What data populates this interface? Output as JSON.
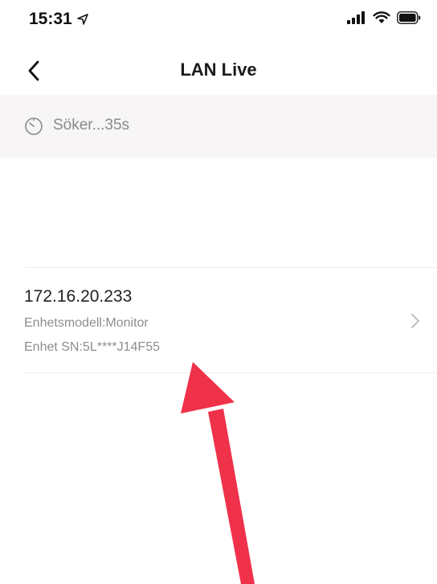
{
  "status_bar": {
    "time": "15:31",
    "location_icon": "location-arrow-icon",
    "signal_icon": "cellular-signal-icon",
    "wifi_icon": "wifi-icon",
    "battery_icon": "battery-icon"
  },
  "nav": {
    "title": "LAN Live",
    "back_icon": "chevron-left-icon"
  },
  "search_banner": {
    "icon": "timer-icon",
    "text": "Söker...35s"
  },
  "devices": [
    {
      "ip": "172.16.20.233",
      "model": "Enhetsmodell:Monitor",
      "serial": "Enhet SN:5L****J14F55"
    }
  ],
  "colors": {
    "banner_bg": "#f7f5f5",
    "annotation_arrow": "#f0314a",
    "secondary_text": "#8e8e8e"
  }
}
